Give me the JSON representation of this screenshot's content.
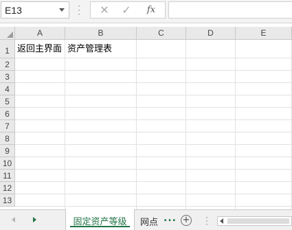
{
  "formula_bar": {
    "name_box": "E13",
    "cancel_icon": "✕",
    "enter_icon": "✓",
    "fx_label": "fx",
    "formula_value": ""
  },
  "grid": {
    "corner_icon": "select-all-triangle",
    "columns": [
      "A",
      "B",
      "C",
      "D",
      "E"
    ],
    "rows": [
      "1",
      "2",
      "3",
      "4",
      "5",
      "6",
      "7",
      "8",
      "9",
      "10",
      "11",
      "12",
      "13"
    ],
    "cells": {
      "A1": "返回主界面",
      "B1": "资产管理表"
    }
  },
  "sheet_tabs": {
    "active": "固定资产等级",
    "second": "网点",
    "more": "...",
    "add": "+"
  },
  "colors": {
    "accent": "#217346",
    "header_bg": "#e9e9e9",
    "gridline": "#e1e1e1"
  }
}
